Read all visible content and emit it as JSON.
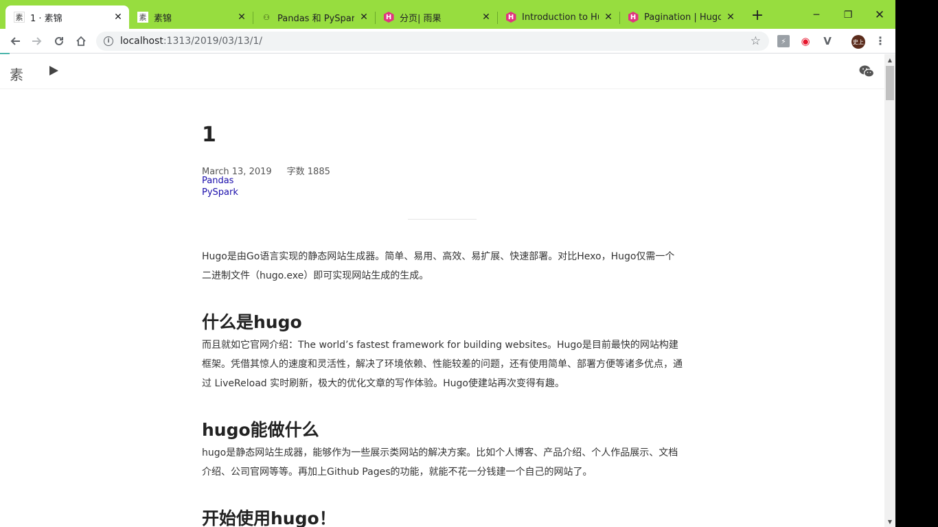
{
  "tabs": [
    {
      "title": "1 · 素锦",
      "favicon": "su-favicon",
      "active": true
    },
    {
      "title": "素锦",
      "favicon": "su-favicon"
    },
    {
      "title": "Pandas 和 PySpark 的",
      "favicon": "github-like-favicon"
    },
    {
      "title": "分页| 雨果",
      "favicon": "hugo-hex-icon"
    },
    {
      "title": "Introduction to Hugo",
      "favicon": "hugo-hex-icon"
    },
    {
      "title": "Pagination | Hugo",
      "favicon": "hugo-hex-icon"
    }
  ],
  "tab_favicon_glyphs": {
    "su": "素",
    "hugo": "H",
    "gh": "⚇"
  },
  "toolbar": {
    "url_host": "localhost",
    "url_rest": ":1313/2019/03/13/1/",
    "profile_label": "史上"
  },
  "site": {
    "logo": "素"
  },
  "post": {
    "title": "1",
    "date": "March 13, 2019",
    "word_count": "字数 1885",
    "tags": [
      "Pandas",
      "PySpark"
    ],
    "intro": "Hugo是由Go语言实现的静态网站生成器。简单、易用、高效、易扩展、快速部署。对比Hexo，Hugo仅需一个二进制文件（hugo.exe）即可实现网站生成的生成。",
    "sections": [
      {
        "heading": "什么是hugo",
        "body": "而且就如它官网介绍：The world’s fastest framework for building websites。Hugo是目前最快的网站构建框架。凭借其惊人的速度和灵活性，解决了环境依赖、性能较差的问题，还有使用简单、部署方便等诸多优点，通过 LiveReload 实时刷新，极大的优化文章的写作体验。Hugo使建站再次变得有趣。"
      },
      {
        "heading": "hugo能做什么",
        "body": "hugo是静态网站生成器，能够作为一些展示类网站的解决方案。比如个人博客、产品介绍、个人作品展示、文档介绍、公司官网等等。再加上Github Pages的功能，就能不花一分钱建一个自己的网站了。"
      },
      {
        "heading": "开始使用hugo！"
      }
    ]
  },
  "colors": {
    "tabstrip": "#97dd3f",
    "link": "#1a0dab",
    "hugo_icon": "#e0357f"
  }
}
